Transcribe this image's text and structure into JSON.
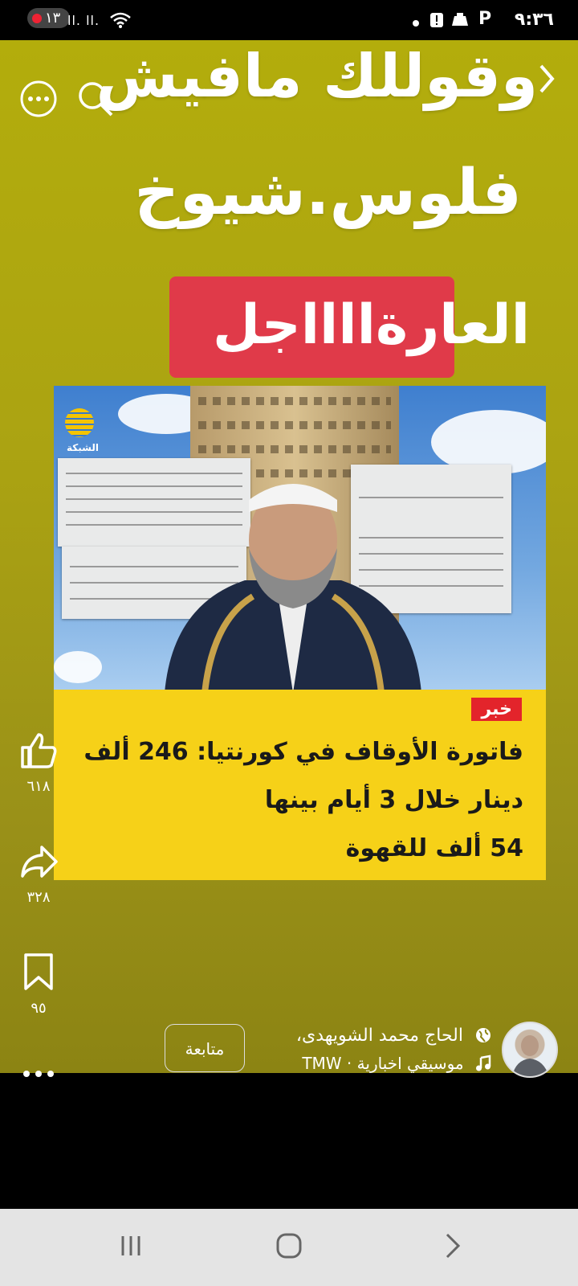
{
  "status_bar": {
    "time": "٩:٣٦",
    "notification_badge": "١٣",
    "signal_text": "ll. ll."
  },
  "reel": {
    "title_line1": "وقوللك مافيش",
    "title_line2": "فلوس.شيوخ",
    "title_line3": "العارةااااجل"
  },
  "news_card": {
    "brand": "الشبكة",
    "tag": "خبر",
    "headline_lines": [
      "فاتورة الأوقاف في كورنتيا: 246 ألف",
      "دينار خلال 3 أيام بينها",
      "54 ألف للقهوة"
    ]
  },
  "actions": {
    "like_count": "٦١٨",
    "share_count": "٣٢٨",
    "save_count": "٩٥"
  },
  "author": {
    "name": "الحاج محمد الشويهدى،",
    "music": "موسيقي اخبارية · TMW",
    "follow_label": "متابعة"
  },
  "colors": {
    "reel_background": "#aba312",
    "banner_red": "#e03a49",
    "news_yellow": "#f6d118",
    "tag_red": "#e3242b"
  }
}
